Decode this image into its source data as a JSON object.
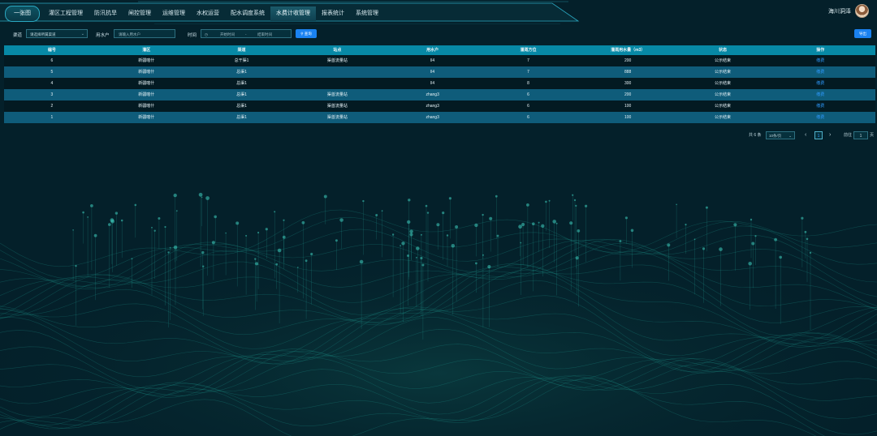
{
  "nav": {
    "home": "一张图",
    "items": [
      "灌区工程管理",
      "防汛抗旱",
      "闸控管理",
      "运维管理",
      "水权运营",
      "配水调度系统",
      "水费计收管理",
      "报表统计",
      "系统管理"
    ],
    "active_index": 6
  },
  "user": {
    "name": "海川洞泽"
  },
  "filters": {
    "channel_label": "渠道",
    "channel_value": "请选择所属渠道",
    "user_label": "用水户",
    "user_placeholder": "请输入用水户",
    "time_label": "时间",
    "start_placeholder": "开始时间",
    "range_sep": "-",
    "end_placeholder": "结束时间",
    "query_button": "查询",
    "export_button": "导出"
  },
  "table": {
    "headers": [
      "编号",
      "灌区",
      "渠道",
      "站点",
      "用水户",
      "灌溉方位",
      "灌溉用水量（m3）",
      "状态",
      "操作"
    ],
    "rows": [
      [
        "6",
        "新疆喀什",
        "总干渠1",
        "渠首流量站",
        "ll4",
        "7",
        "200",
        "公示结束",
        "缴费"
      ],
      [
        "5",
        "新疆喀什",
        "总渠1",
        "",
        "ll4",
        "7",
        "888",
        "公示结束",
        "缴费"
      ],
      [
        "4",
        "新疆喀什",
        "总渠1",
        "",
        "ll4",
        "8",
        "300",
        "公示结束",
        "缴费"
      ],
      [
        "3",
        "新疆喀什",
        "总渠1",
        "渠首流量站",
        "zhang3",
        "6",
        "200",
        "公示结束",
        "缴费"
      ],
      [
        "2",
        "新疆喀什",
        "总渠1",
        "渠首流量站",
        "zhang3",
        "6",
        "100",
        "公示结束",
        "缴费"
      ],
      [
        "1",
        "新疆喀什",
        "总渠1",
        "渠首流量站",
        "zhang3",
        "6",
        "100",
        "公示结束",
        "缴费"
      ]
    ]
  },
  "pagination": {
    "total": "共 6 条",
    "page_size": "10条/页",
    "current_page": "1",
    "goto_label": "前往",
    "goto_value": "1",
    "page_unit": "页",
    "prev": "‹",
    "next": "›"
  },
  "colors": {
    "background": "#04202a",
    "header": "#0789a6",
    "row_alt": "#0f5c7a",
    "accent": "#1a82f0"
  }
}
